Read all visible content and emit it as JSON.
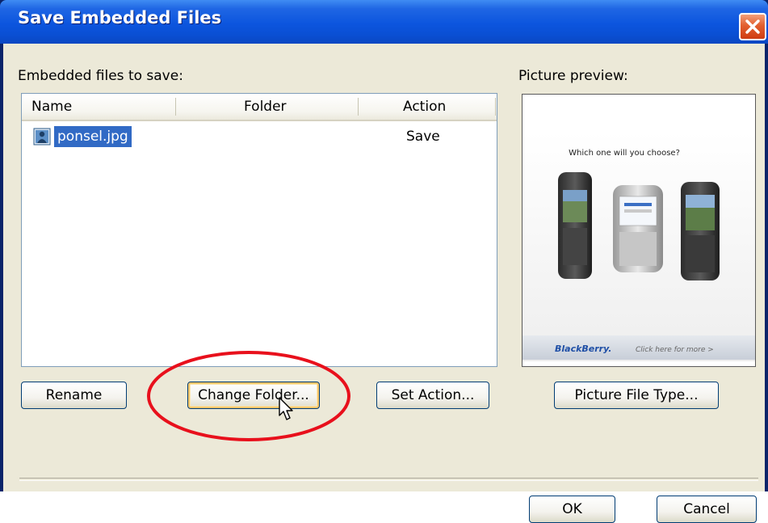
{
  "window": {
    "title": "Save Embedded Files"
  },
  "left_panel": {
    "label": "Embedded files to save:",
    "columns": [
      "Name",
      "Folder",
      "Action"
    ],
    "rows": [
      {
        "name": "ponsel.jpg",
        "folder": "",
        "action": "Save",
        "selected": true
      }
    ]
  },
  "buttons": {
    "rename": "Rename",
    "change_folder": "Change Folder...",
    "set_action": "Set Action...",
    "picture_file_type": "Picture File Type...",
    "ok": "OK",
    "cancel": "Cancel"
  },
  "right_panel": {
    "label": "Picture preview:",
    "preview": {
      "headline": "Which one will you choose?",
      "brand": "BlackBerry.",
      "tagline": "Click here for more >"
    }
  },
  "colors": {
    "title_bar": "#0a4fd3",
    "dialog_bg": "#ece9d8",
    "selection": "#316ac5",
    "annotation": "#e8101c"
  },
  "icons": [
    "close-icon",
    "image-file-icon",
    "mouse-cursor-icon"
  ]
}
